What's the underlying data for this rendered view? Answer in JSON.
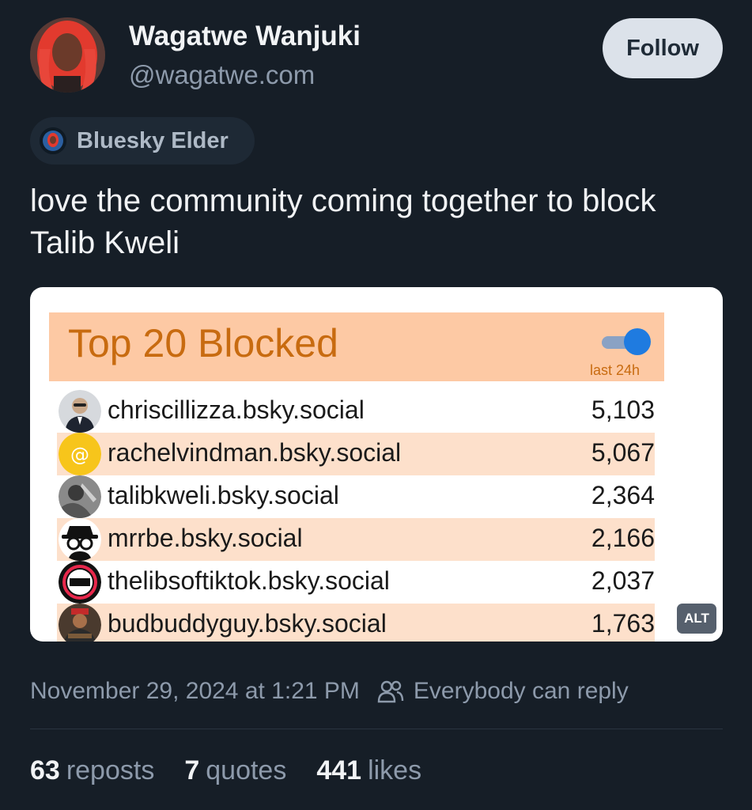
{
  "author": {
    "name": "Wagatwe Wanjuki",
    "handle": "@wagatwe.com",
    "follow_label": "Follow"
  },
  "badge": {
    "label": "Bluesky Elder"
  },
  "post": {
    "text": "love the community coming together to block Talib Kweli"
  },
  "image_card": {
    "title": "Top 20 Blocked",
    "toggle_caption": "last 24h",
    "toggle_on": true,
    "alt_label": "ALT",
    "rows": [
      {
        "handle": "chriscillizza.bsky.social",
        "count": "5,103",
        "avatar": "person-photo"
      },
      {
        "handle": "rachelvindman.bsky.social",
        "count": "5,067",
        "avatar": "at-sign-icon"
      },
      {
        "handle": "talibkweli.bsky.social",
        "count": "2,364",
        "avatar": "person-photo"
      },
      {
        "handle": "mrrbe.bsky.social",
        "count": "2,166",
        "avatar": "spy-icon"
      },
      {
        "handle": "thelibsoftiktok.bsky.social",
        "count": "2,037",
        "avatar": "libs-of-tiktok-logo"
      },
      {
        "handle": "budbuddyguy.bsky.social",
        "count": "1,763",
        "avatar": "person-photo"
      }
    ]
  },
  "meta": {
    "timestamp": "November 29, 2024 at 1:21 PM",
    "reply_setting": "Everybody can reply"
  },
  "stats": {
    "reposts_count": "63",
    "reposts_label": "reposts",
    "quotes_count": "7",
    "quotes_label": "quotes",
    "likes_count": "441",
    "likes_label": "likes"
  },
  "colors": {
    "background": "#161e27",
    "card_header": "#fdc9a4",
    "card_title": "#c86b10",
    "row_alt": "#fde0cb",
    "toggle": "#1f7be0",
    "follow_button": "#dce2ea"
  }
}
